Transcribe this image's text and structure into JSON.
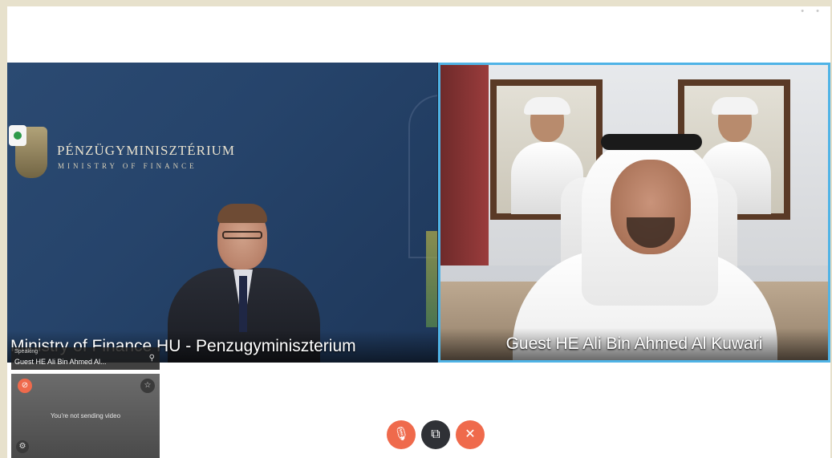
{
  "tiles": {
    "left": {
      "org_name": "PÉNZÜGYMINISZTÉRIUM",
      "org_sub": "MINISTRY OF FINANCE",
      "caption": "Ministry of Finance HU - Penzugyminiszterium"
    },
    "right": {
      "caption": "Guest HE Ali Bin Ahmed Al Kuwari"
    }
  },
  "self_view": {
    "status_label": "Speaking",
    "speaker": "Guest HE Ali Bin Ahmed Al...",
    "message": "You're not sending video"
  },
  "colors": {
    "accent": "#4fb3e6",
    "end_call": "#ef6a4c",
    "control_dark": "#2f3136"
  },
  "icons": [
    "camera-on-icon",
    "pin-icon",
    "mic-off-icon",
    "star-icon",
    "settings-icon",
    "share-icon",
    "close-icon"
  ]
}
